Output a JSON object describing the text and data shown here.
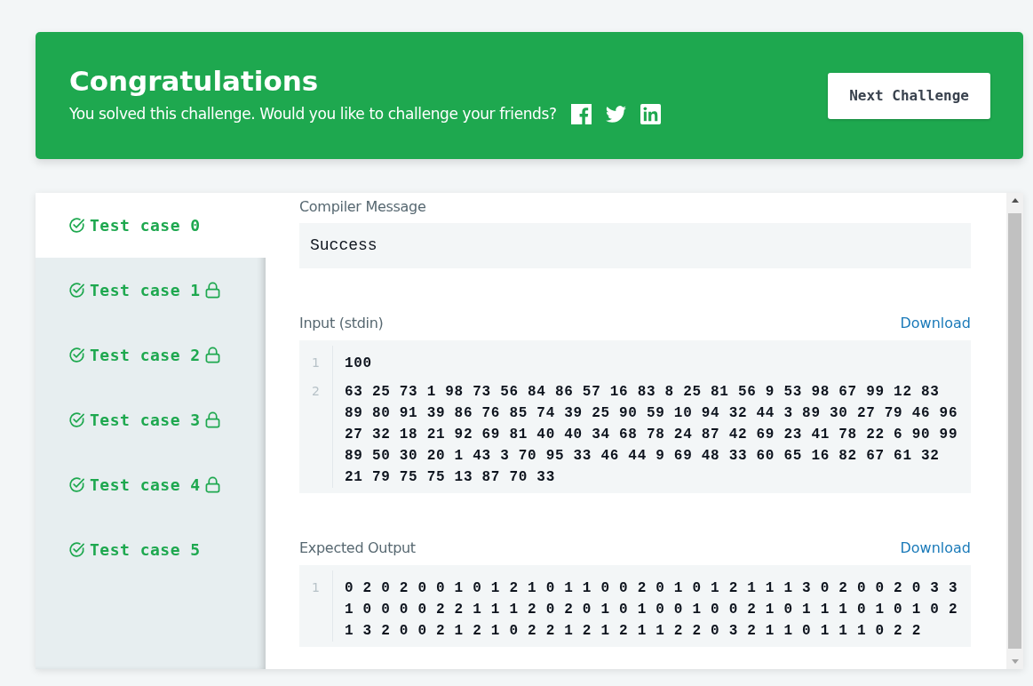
{
  "banner": {
    "title": "Congratulations",
    "message": "You solved this challenge. Would you like to challenge your friends?",
    "share": [
      {
        "kind": "facebook"
      },
      {
        "kind": "twitter"
      },
      {
        "kind": "linkedin"
      }
    ],
    "button": "Next Challenge"
  },
  "test_cases": [
    {
      "label": "Test case 0",
      "selected": true,
      "passed": true,
      "locked": false
    },
    {
      "label": "Test case 1",
      "selected": false,
      "passed": true,
      "locked": true
    },
    {
      "label": "Test case 2",
      "selected": false,
      "passed": true,
      "locked": true
    },
    {
      "label": "Test case 3",
      "selected": false,
      "passed": true,
      "locked": true
    },
    {
      "label": "Test case 4",
      "selected": false,
      "passed": true,
      "locked": true
    },
    {
      "label": "Test case 5",
      "selected": false,
      "passed": true,
      "locked": false
    }
  ],
  "compiler": {
    "label": "Compiler Message",
    "message": "Success"
  },
  "sections": [
    {
      "label": "Input (stdin)",
      "download": "Download",
      "lines": [
        {
          "number": "1",
          "text": "100"
        },
        {
          "number": "2",
          "text": "63 25 73 1 98 73 56 84 86 57 16 83 8 25 81 56 9 53 98 67 99 12 83 89 80 91 39 86 76 85 74 39 25 90 59 10 94 32 44 3 89 30 27 79 46 96 27 32 18 21 92 69 81 40 40 34 68 78 24 87 42 69 23 41 78 22 6 90 99 89 50 30 20 1 43 3 70 95 33 46 44 9 69 48 33 60 65 16 82 67 61 32 21 79 75 75 13 87 70 33"
        }
      ]
    },
    {
      "label": "Expected Output",
      "download": "Download",
      "lines": [
        {
          "number": "1",
          "text": "0 2 0 2 0 0 1 0 1 2 1 0 1 1 0 0 2 0 1 0 1 2 1 1 1 3 0 2 0 0 2 0 3 3 1 0 0 0 0 2 2 1 1 1 2 0 2 0 1 0 1 0 0 1 0 0 2 1 0 1 1 1 0 1 0 1 0 2 1 3 2 0 0 2 1 2 1 0 2 2 1 2 1 2 1 1 2 2 0 3 2 1 1 0 1 1 1 0 2 2"
        }
      ]
    }
  ]
}
